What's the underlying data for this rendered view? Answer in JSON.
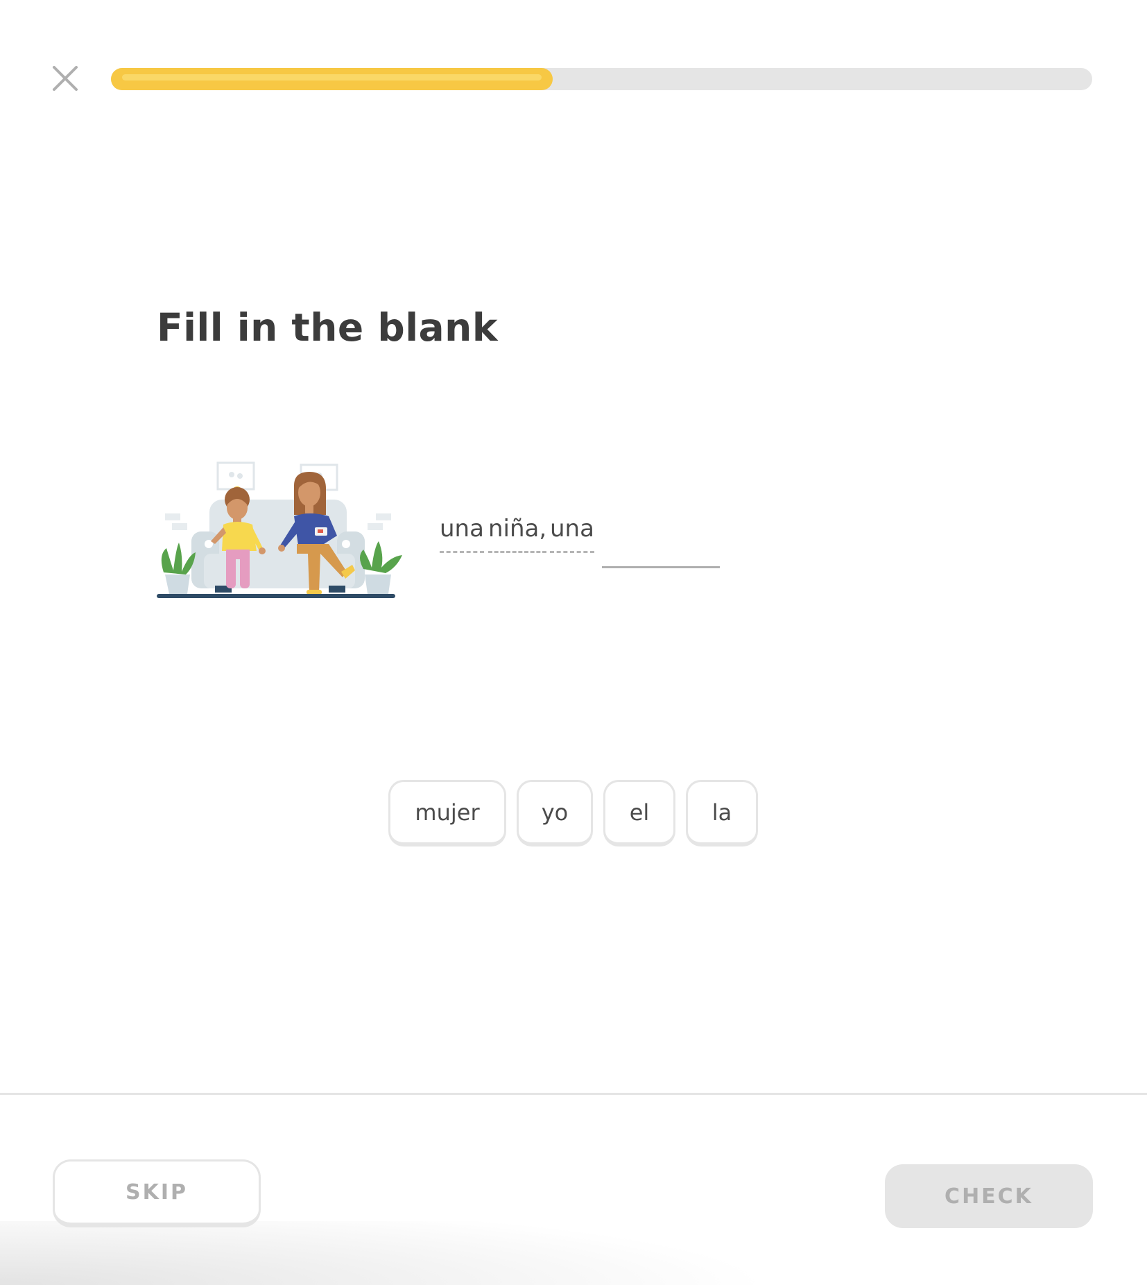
{
  "lesson": {
    "progress_fraction": 0.45
  },
  "challenge": {
    "prompt": "Fill in the blank",
    "sentence_tokens": [
      "una",
      "niña,",
      "una"
    ]
  },
  "word_bank": [
    "mujer",
    "yo",
    "el",
    "la"
  ],
  "footer": {
    "skip_label": "SKIP",
    "check_label": "CHECK"
  },
  "colors": {
    "progress_fill": "#f7c844",
    "progress_track": "#e5e5e5",
    "title_text": "#3c3c3c",
    "disabled_text": "#afafaf"
  },
  "icons": {
    "close": "close-icon"
  }
}
